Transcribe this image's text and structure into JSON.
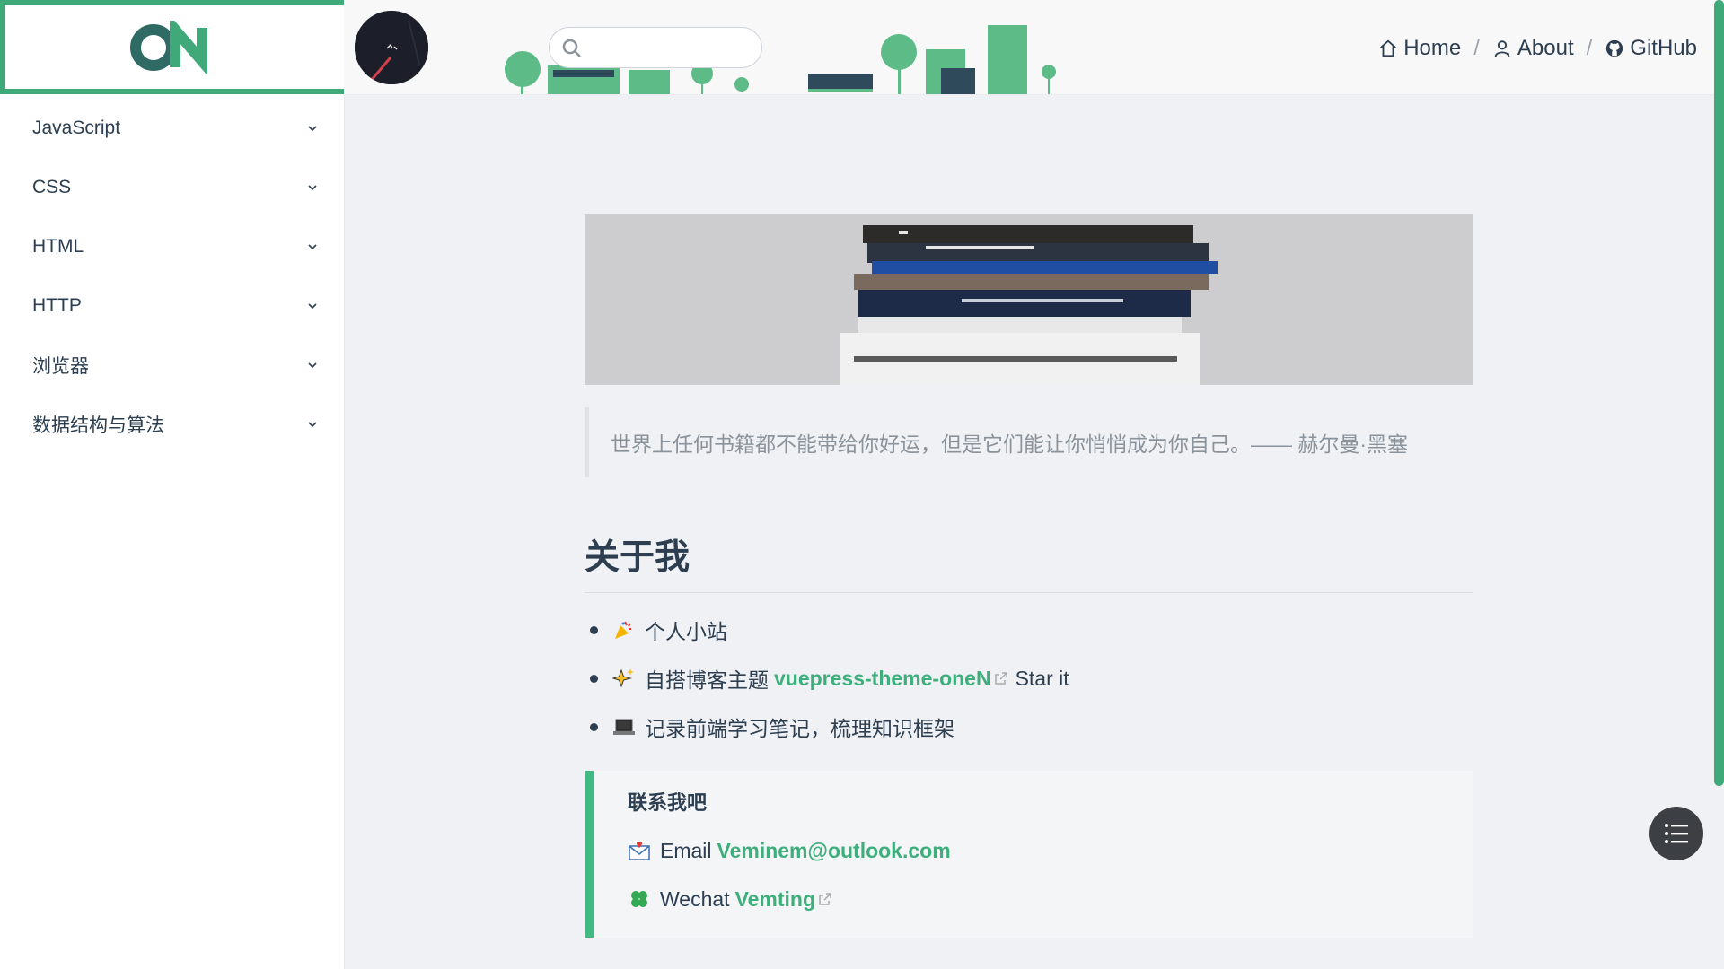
{
  "sidebar": {
    "items": [
      {
        "label": "JavaScript"
      },
      {
        "label": "CSS"
      },
      {
        "label": "HTML"
      },
      {
        "label": "HTTP"
      },
      {
        "label": "浏览器"
      },
      {
        "label": "数据结构与算法"
      }
    ]
  },
  "header": {
    "search": {
      "placeholder": "",
      "value": ""
    },
    "nav": {
      "home": "Home",
      "about": "About",
      "github": "GitHub",
      "separator": "/"
    }
  },
  "main": {
    "quote": "世界上任何书籍都不能带给你好运，但是它们能让你悄悄成为你自己。—— 赫尔曼·黑塞",
    "about_title": "关于我",
    "items": [
      {
        "text": "个人小站",
        "icon": "party-popper-icon"
      },
      {
        "text": "自搭博客主题",
        "link": "vuepress-theme-oneN",
        "suffix": "Star it",
        "icon": "sparkles-icon"
      },
      {
        "text": "记录前端学习笔记，梳理知识框架",
        "icon": "laptop-icon"
      }
    ],
    "contact": {
      "title": "联系我吧",
      "email_label": "Email",
      "email": "Veminem@outlook.com",
      "wechat_label": "Wechat",
      "wechat": "Vemting"
    }
  },
  "colors": {
    "accent": "#3eaf7c",
    "scrollbar": "#3fa97a",
    "text": "#2c3e50"
  }
}
